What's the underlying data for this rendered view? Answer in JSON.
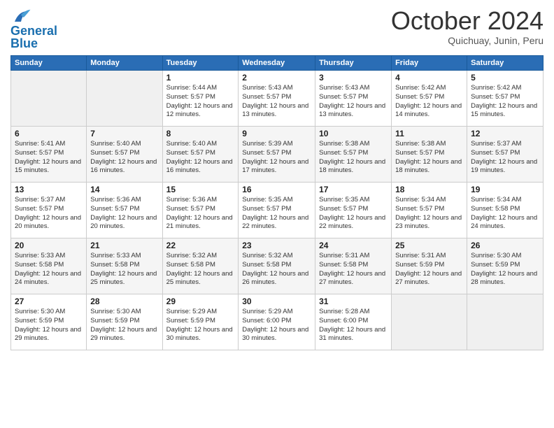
{
  "header": {
    "logo_line1": "General",
    "logo_line2": "Blue",
    "month": "October 2024",
    "location": "Quichuay, Junin, Peru"
  },
  "weekdays": [
    "Sunday",
    "Monday",
    "Tuesday",
    "Wednesday",
    "Thursday",
    "Friday",
    "Saturday"
  ],
  "weeks": [
    [
      {
        "day": "",
        "info": ""
      },
      {
        "day": "",
        "info": ""
      },
      {
        "day": "1",
        "sunrise": "5:44 AM",
        "sunset": "5:57 PM",
        "daylight": "12 hours and 12 minutes."
      },
      {
        "day": "2",
        "sunrise": "5:43 AM",
        "sunset": "5:57 PM",
        "daylight": "12 hours and 13 minutes."
      },
      {
        "day": "3",
        "sunrise": "5:43 AM",
        "sunset": "5:57 PM",
        "daylight": "12 hours and 13 minutes."
      },
      {
        "day": "4",
        "sunrise": "5:42 AM",
        "sunset": "5:57 PM",
        "daylight": "12 hours and 14 minutes."
      },
      {
        "day": "5",
        "sunrise": "5:42 AM",
        "sunset": "5:57 PM",
        "daylight": "12 hours and 15 minutes."
      }
    ],
    [
      {
        "day": "6",
        "sunrise": "5:41 AM",
        "sunset": "5:57 PM",
        "daylight": "12 hours and 15 minutes."
      },
      {
        "day": "7",
        "sunrise": "5:40 AM",
        "sunset": "5:57 PM",
        "daylight": "12 hours and 16 minutes."
      },
      {
        "day": "8",
        "sunrise": "5:40 AM",
        "sunset": "5:57 PM",
        "daylight": "12 hours and 16 minutes."
      },
      {
        "day": "9",
        "sunrise": "5:39 AM",
        "sunset": "5:57 PM",
        "daylight": "12 hours and 17 minutes."
      },
      {
        "day": "10",
        "sunrise": "5:38 AM",
        "sunset": "5:57 PM",
        "daylight": "12 hours and 18 minutes."
      },
      {
        "day": "11",
        "sunrise": "5:38 AM",
        "sunset": "5:57 PM",
        "daylight": "12 hours and 18 minutes."
      },
      {
        "day": "12",
        "sunrise": "5:37 AM",
        "sunset": "5:57 PM",
        "daylight": "12 hours and 19 minutes."
      }
    ],
    [
      {
        "day": "13",
        "sunrise": "5:37 AM",
        "sunset": "5:57 PM",
        "daylight": "12 hours and 20 minutes."
      },
      {
        "day": "14",
        "sunrise": "5:36 AM",
        "sunset": "5:57 PM",
        "daylight": "12 hours and 20 minutes."
      },
      {
        "day": "15",
        "sunrise": "5:36 AM",
        "sunset": "5:57 PM",
        "daylight": "12 hours and 21 minutes."
      },
      {
        "day": "16",
        "sunrise": "5:35 AM",
        "sunset": "5:57 PM",
        "daylight": "12 hours and 22 minutes."
      },
      {
        "day": "17",
        "sunrise": "5:35 AM",
        "sunset": "5:57 PM",
        "daylight": "12 hours and 22 minutes."
      },
      {
        "day": "18",
        "sunrise": "5:34 AM",
        "sunset": "5:57 PM",
        "daylight": "12 hours and 23 minutes."
      },
      {
        "day": "19",
        "sunrise": "5:34 AM",
        "sunset": "5:58 PM",
        "daylight": "12 hours and 24 minutes."
      }
    ],
    [
      {
        "day": "20",
        "sunrise": "5:33 AM",
        "sunset": "5:58 PM",
        "daylight": "12 hours and 24 minutes."
      },
      {
        "day": "21",
        "sunrise": "5:33 AM",
        "sunset": "5:58 PM",
        "daylight": "12 hours and 25 minutes."
      },
      {
        "day": "22",
        "sunrise": "5:32 AM",
        "sunset": "5:58 PM",
        "daylight": "12 hours and 25 minutes."
      },
      {
        "day": "23",
        "sunrise": "5:32 AM",
        "sunset": "5:58 PM",
        "daylight": "12 hours and 26 minutes."
      },
      {
        "day": "24",
        "sunrise": "5:31 AM",
        "sunset": "5:58 PM",
        "daylight": "12 hours and 27 minutes."
      },
      {
        "day": "25",
        "sunrise": "5:31 AM",
        "sunset": "5:59 PM",
        "daylight": "12 hours and 27 minutes."
      },
      {
        "day": "26",
        "sunrise": "5:30 AM",
        "sunset": "5:59 PM",
        "daylight": "12 hours and 28 minutes."
      }
    ],
    [
      {
        "day": "27",
        "sunrise": "5:30 AM",
        "sunset": "5:59 PM",
        "daylight": "12 hours and 29 minutes."
      },
      {
        "day": "28",
        "sunrise": "5:30 AM",
        "sunset": "5:59 PM",
        "daylight": "12 hours and 29 minutes."
      },
      {
        "day": "29",
        "sunrise": "5:29 AM",
        "sunset": "5:59 PM",
        "daylight": "12 hours and 30 minutes."
      },
      {
        "day": "30",
        "sunrise": "5:29 AM",
        "sunset": "6:00 PM",
        "daylight": "12 hours and 30 minutes."
      },
      {
        "day": "31",
        "sunrise": "5:28 AM",
        "sunset": "6:00 PM",
        "daylight": "12 hours and 31 minutes."
      },
      {
        "day": "",
        "info": ""
      },
      {
        "day": "",
        "info": ""
      }
    ]
  ]
}
